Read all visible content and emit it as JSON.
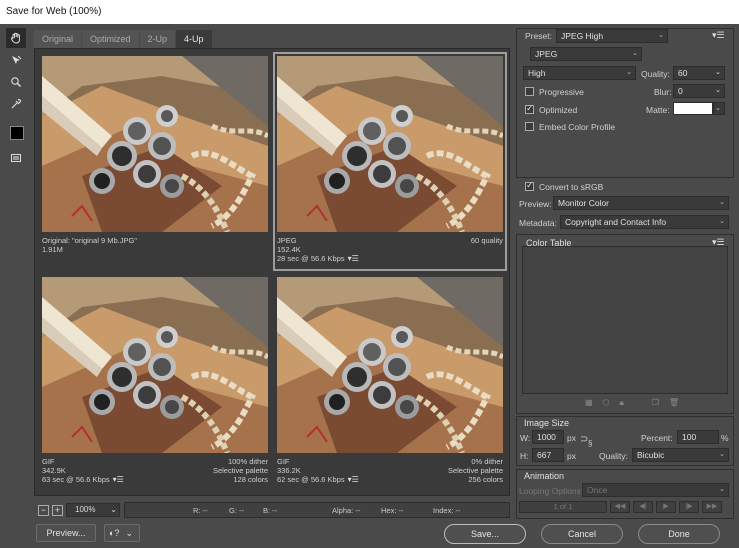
{
  "window": {
    "title": "Save for Web (100%)"
  },
  "tools": [
    {
      "name": "hand-tool-icon"
    },
    {
      "name": "slice-select-tool-icon"
    },
    {
      "name": "zoom-tool-icon"
    },
    {
      "name": "eyedropper-tool-icon"
    },
    {
      "name": "eyedropper-color-swatch"
    },
    {
      "name": "toggle-slices-icon"
    }
  ],
  "tabs": [
    {
      "label": "Original",
      "active": false
    },
    {
      "label": "Optimized",
      "active": false
    },
    {
      "label": "2-Up",
      "active": false
    },
    {
      "label": "4-Up",
      "active": true
    }
  ],
  "panes": [
    {
      "line1_left": "Original: \"original 9 Mb.JPG\"",
      "line1_right": "",
      "line2_left": "1.91M",
      "line2_right": "",
      "line3_left": "",
      "line3_right": "",
      "selected": false
    },
    {
      "line1_left": "JPEG",
      "line1_right": "60 quality",
      "line2_left": "152.4K",
      "line2_right": "",
      "line3_left": "28 sec @ 56.6 Kbps",
      "line3_right": "",
      "selected": true
    },
    {
      "line1_left": "GIF",
      "line1_right": "100% dither",
      "line2_left": "342.9K",
      "line2_right": "Selective palette",
      "line3_left": "63 sec @ 56.6 Kbps",
      "line3_right": "128 colors",
      "selected": false
    },
    {
      "line1_left": "GIF",
      "line1_right": "0% dither",
      "line2_left": "336.2K",
      "line2_right": "Selective palette",
      "line3_left": "62 sec @ 56.6 Kbps",
      "line3_right": "256 colors",
      "selected": false
    }
  ],
  "statusbar": {
    "zoom_out": "−",
    "zoom_in": "+",
    "zoom": "100%",
    "r": "R: --",
    "g": "G: --",
    "b": "B: --",
    "alpha": "Alpha: --",
    "hex": "Hex: --",
    "index": "Index: --"
  },
  "bottom_left": {
    "preview_label": "Preview...",
    "browser_icon": "browser-icon"
  },
  "settings": {
    "preset_label": "Preset:",
    "preset_value": "JPEG High",
    "format": "JPEG",
    "quality_level": "High",
    "quality_label": "Quality:",
    "quality_value": "60",
    "progressive_label": "Progressive",
    "progressive_checked": false,
    "blur_label": "Blur:",
    "blur_value": "0",
    "optimized_label": "Optimized",
    "optimized_checked": true,
    "matte_label": "Matte:",
    "matte_color": "#ffffff",
    "embed_profile_label": "Embed Color Profile",
    "embed_profile_checked": false,
    "convert_srgb_label": "Convert to sRGB",
    "convert_srgb_checked": true,
    "preview_label": "Preview:",
    "preview_value": "Monitor Color",
    "metadata_label": "Metadata:",
    "metadata_value": "Copyright and Contact Info"
  },
  "color_table": {
    "title": "Color Table"
  },
  "image_size": {
    "title": "Image Size",
    "w_label": "W:",
    "w_value": "1000",
    "h_label": "H:",
    "h_value": "667",
    "unit": "px",
    "percent_label": "Percent:",
    "percent_value": "100",
    "percent_unit": "%",
    "quality_label": "Quality:",
    "quality_value": "Bicubic"
  },
  "animation": {
    "title": "Animation",
    "looping_label": "Looping Options:",
    "looping_value": "Once",
    "frame_counter": "1 of 1"
  },
  "buttons": {
    "save": "Save...",
    "cancel": "Cancel",
    "done": "Done"
  },
  "colors": {
    "panel_bg": "#4a4a4a",
    "field_bg": "#3a3a3a",
    "titlebar_bg": "#ffffff"
  }
}
